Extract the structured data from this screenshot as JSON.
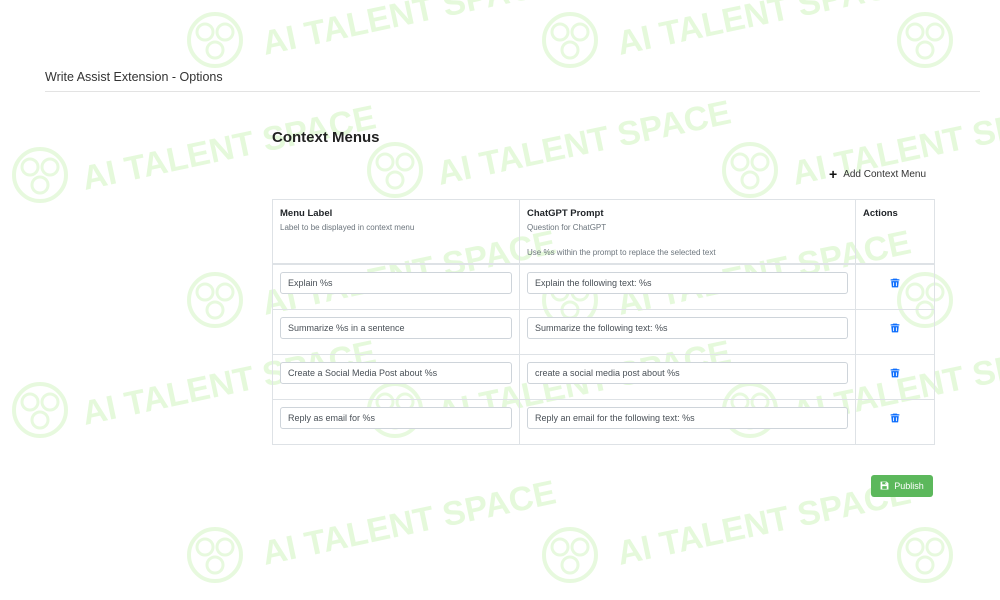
{
  "header": {
    "title": "Write Assist Extension - Options"
  },
  "section": {
    "title": "Context Menus",
    "add_label": "Add Context Menu"
  },
  "table": {
    "columns": [
      {
        "title": "Menu Label",
        "subtitle": "Label to be displayed in context menu",
        "note": ""
      },
      {
        "title": "ChatGPT Prompt",
        "subtitle": "Question for ChatGPT",
        "note": "Use %s within the prompt to replace the selected text"
      },
      {
        "title": "Actions",
        "subtitle": "",
        "note": ""
      }
    ],
    "rows": [
      {
        "label": "Explain %s",
        "prompt": "Explain the following text: %s"
      },
      {
        "label": "Summarize %s in a sentence",
        "prompt": "Summarize the following text: %s"
      },
      {
        "label": "Create a Social Media Post about %s",
        "prompt": "create a social media post about %s"
      },
      {
        "label": "Reply as email for %s",
        "prompt": "Reply an email for the following text: %s"
      }
    ]
  },
  "publish": {
    "label": "Publish",
    "icon": "floppy-disk-icon",
    "color": "#5cb85c"
  },
  "icons": {
    "add": "plus-icon",
    "delete": "trash-icon"
  },
  "colors": {
    "delete_icon": "#0d6efd",
    "watermark": "#c8f0b4"
  },
  "watermark": {
    "text": "AI TALENT SPACE"
  }
}
